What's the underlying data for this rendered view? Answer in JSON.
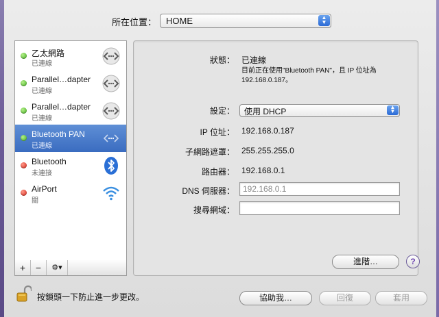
{
  "location": {
    "label": "所在位置：",
    "value": "HOME"
  },
  "services": [
    {
      "name": "乙太網路",
      "status": "已連線",
      "state": "green",
      "icon": "ethernet-arrows-icon",
      "selected": false
    },
    {
      "name": "Parallel…dapter",
      "status": "已連線",
      "state": "green",
      "icon": "ethernet-arrows-icon",
      "selected": false
    },
    {
      "name": "Parallel…dapter",
      "status": "已連線",
      "state": "green",
      "icon": "ethernet-arrows-icon",
      "selected": false
    },
    {
      "name": "Bluetooth PAN",
      "status": "已連線",
      "state": "green",
      "icon": "ethernet-arrows-icon",
      "selected": true
    },
    {
      "name": "Bluetooth",
      "status": "未連接",
      "state": "red",
      "icon": "bluetooth-icon",
      "selected": false
    },
    {
      "name": "AirPort",
      "status": "關",
      "state": "red",
      "icon": "wifi-icon",
      "selected": false
    }
  ],
  "list_buttons": {
    "add": "+",
    "remove": "−",
    "gear": "⚙▾"
  },
  "detail": {
    "status_label": "狀態：",
    "status_value": "已連線",
    "status_note_1": "目前正在使用\"Bluetooth PAN\"，且 IP 位址為",
    "status_note_2": "192.168.0.187。",
    "config_label": "設定：",
    "config_value": "使用 DHCP",
    "ip_label": "IP 位址：",
    "ip_value": "192.168.0.187",
    "subnet_label": "子網路遮罩：",
    "subnet_value": "255.255.255.0",
    "router_label": "路由器：",
    "router_value": "192.168.0.1",
    "dns_label": "DNS 伺服器：",
    "dns_placeholder": "192.168.0.1",
    "search_label": "搜尋網域：",
    "search_value": ""
  },
  "buttons": {
    "advanced": "進階…",
    "help": "?",
    "assist": "協助我…",
    "revert": "回復",
    "apply": "套用"
  },
  "lock_text": "按鎖頭一下防止進一步更改。",
  "colors": {
    "selection": "#3a6cc0",
    "connected": "#3daa1e",
    "disconnected": "#d01f14"
  }
}
